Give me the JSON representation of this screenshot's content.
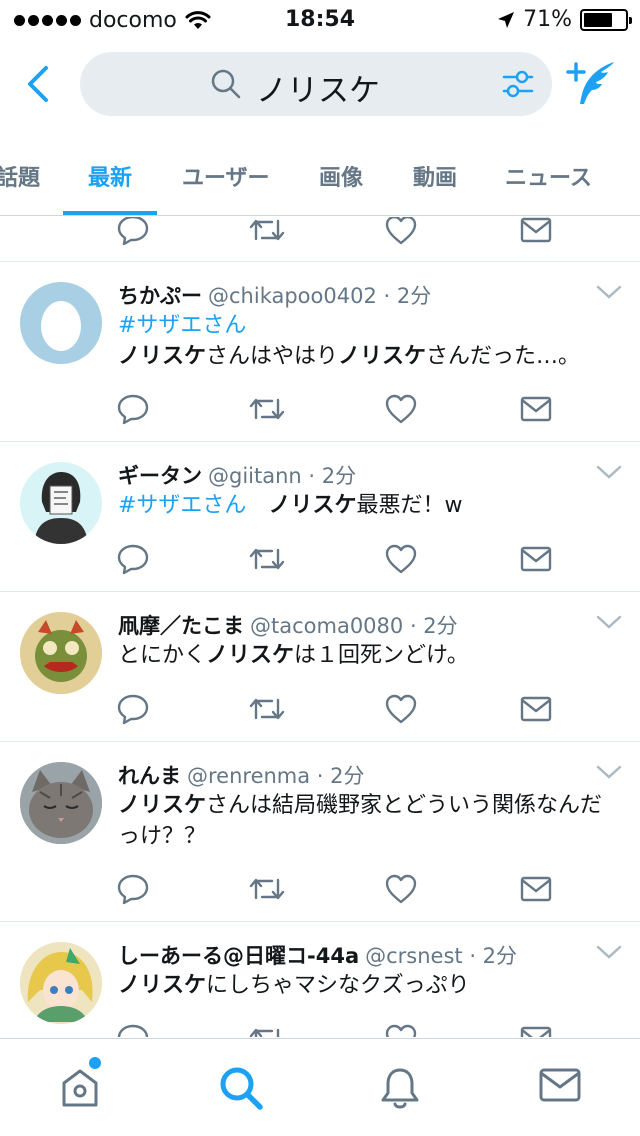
{
  "status": {
    "carrier": "docomo",
    "time": "18:54",
    "battery": "71%",
    "battery_level": 0.71
  },
  "search": {
    "query": "ノリスケ"
  },
  "tabs": [
    {
      "label": "話題"
    },
    {
      "label": "最新"
    },
    {
      "label": "ユーザー"
    },
    {
      "label": "画像"
    },
    {
      "label": "動画"
    },
    {
      "label": "ニュース"
    }
  ],
  "tweets": [
    {
      "name": "ちかぷー",
      "handle": "@chikapoo0402 · 2分",
      "hashtag": "#サザエさん",
      "body": [
        {
          "t": "ノリスケ",
          "b": true
        },
        {
          "t": "さんはやはり",
          "b": false
        },
        {
          "t": "ノリスケ",
          "b": true
        },
        {
          "t": "さんだった…。",
          "b": false
        }
      ]
    },
    {
      "name": "ギータン",
      "handle": "@giitann · 2分",
      "hashtag": "#サザエさん",
      "body": [
        {
          "t": "　ノリスケ",
          "b": true
        },
        {
          "t": "最悪だ！w",
          "b": false
        }
      ]
    },
    {
      "name": "凧摩／たこま",
      "handle": "@tacoma0080 · 2分",
      "body": [
        {
          "t": "とにかく",
          "b": false
        },
        {
          "t": "ノリスケ",
          "b": true
        },
        {
          "t": "は１回死ンどけ。",
          "b": false
        }
      ]
    },
    {
      "name": "れんま",
      "handle": "@renrenma · 2分",
      "body": [
        {
          "t": "ノリスケ",
          "b": true
        },
        {
          "t": "さんは結局磯野家とどういう関係なんだっけ？？",
          "b": false
        }
      ]
    },
    {
      "name": "しーあーる@日曜コ-44a",
      "handle": "@crsnest · 2分",
      "body": [
        {
          "t": "ノリスケ",
          "b": true
        },
        {
          "t": "にしちゃマシなクズっぷり",
          "b": false
        }
      ]
    }
  ],
  "colors": {
    "accent": "#1da1f2",
    "icon_gray": "#657786",
    "search_bg": "#e6ecf0",
    "divider": "#e1e8ed"
  },
  "icons": {
    "reply": "speech-bubble",
    "retweet": "retweet-arrows",
    "like": "heart",
    "dm": "envelope",
    "home": "house",
    "search": "magnifier",
    "notifications": "bell",
    "messages": "envelope"
  }
}
